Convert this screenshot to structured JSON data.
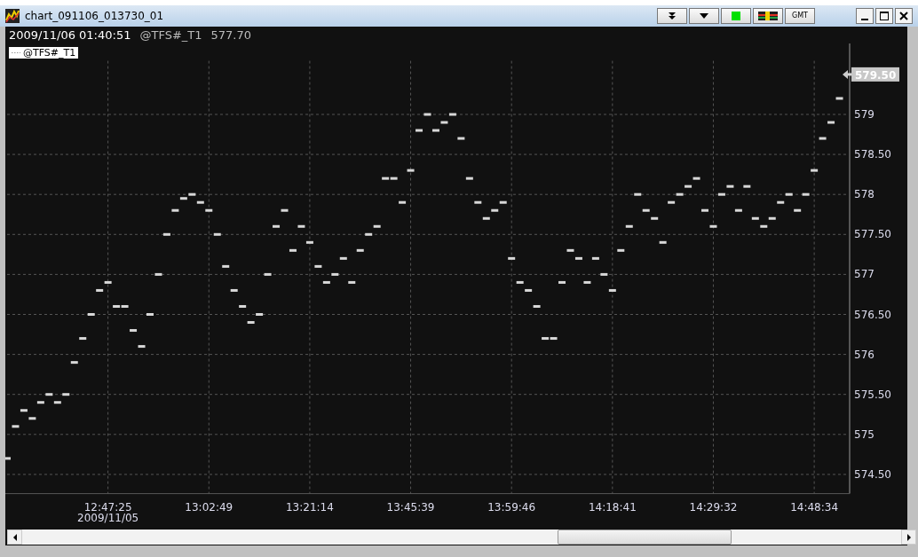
{
  "window": {
    "title": "chart_091106_013730_01"
  },
  "toolbar": [
    {
      "kind": "double-caret"
    },
    {
      "kind": "caret"
    },
    {
      "kind": "status",
      "color": "#00e000"
    },
    {
      "kind": "flag"
    },
    {
      "kind": "text",
      "label": "GMT"
    }
  ],
  "info": {
    "timestamp": "2009/11/06 01:40:51",
    "symbol": "@TFS#_T1",
    "price": "577.70"
  },
  "last_price": "579.50",
  "date_label": "2009/11/05",
  "chart_data": {
    "type": "scatter",
    "grid": true,
    "ylim": [
      574.26,
      579.67
    ],
    "yticks": [
      {
        "value": 574.5,
        "label": "574.50"
      },
      {
        "value": 575,
        "label": "575"
      },
      {
        "value": 575.5,
        "label": "575.50"
      },
      {
        "value": 576,
        "label": "576"
      },
      {
        "value": 576.5,
        "label": "576.50"
      },
      {
        "value": 577,
        "label": "577"
      },
      {
        "value": 577.5,
        "label": "577.50"
      },
      {
        "value": 578,
        "label": "578"
      },
      {
        "value": 578.5,
        "label": "578.50"
      },
      {
        "value": 579,
        "label": "579"
      }
    ],
    "categories": [
      null,
      null,
      null,
      null,
      null,
      null,
      null,
      null,
      null,
      null,
      null,
      null,
      "12:47:25",
      null,
      null,
      null,
      null,
      null,
      null,
      null,
      null,
      null,
      null,
      null,
      "13:02:49",
      null,
      null,
      null,
      null,
      null,
      null,
      null,
      null,
      null,
      null,
      null,
      "13:21:14",
      null,
      null,
      null,
      null,
      null,
      null,
      null,
      null,
      null,
      null,
      null,
      "13:45:39",
      null,
      null,
      null,
      null,
      null,
      null,
      null,
      null,
      null,
      null,
      null,
      "13:59:46",
      null,
      null,
      null,
      null,
      null,
      null,
      null,
      null,
      null,
      null,
      null,
      "14:18:41",
      null,
      null,
      null,
      null,
      null,
      null,
      null,
      null,
      null,
      null,
      null,
      "14:29:32",
      null,
      null,
      null,
      null,
      null,
      null,
      null,
      null,
      null,
      null,
      null,
      "14:48:34",
      null,
      null,
      null,
      null
    ],
    "series": [
      {
        "name": "@TFS#_T1",
        "color": "#d8d8d8",
        "values": [
          574.7,
          575.1,
          575.3,
          575.2,
          575.4,
          575.5,
          575.4,
          575.5,
          575.9,
          576.2,
          576.5,
          576.8,
          576.9,
          576.6,
          576.6,
          576.3,
          576.1,
          576.5,
          577.0,
          577.5,
          577.8,
          577.95,
          578.0,
          577.9,
          577.8,
          577.5,
          577.1,
          576.8,
          576.6,
          576.4,
          576.5,
          577.0,
          577.6,
          577.8,
          577.3,
          577.6,
          577.4,
          577.1,
          576.9,
          577.0,
          577.2,
          576.9,
          577.3,
          577.5,
          577.6,
          578.2,
          578.2,
          577.9,
          578.3,
          578.8,
          579.0,
          578.8,
          578.9,
          579.0,
          578.7,
          578.2,
          577.9,
          577.7,
          577.8,
          577.9,
          577.2,
          576.9,
          576.8,
          576.6,
          576.2,
          576.2,
          576.9,
          577.3,
          577.2,
          576.9,
          577.2,
          577.0,
          576.8,
          577.3,
          577.6,
          578.0,
          577.8,
          577.7,
          577.4,
          577.9,
          578.0,
          578.1,
          578.2,
          577.8,
          577.6,
          578.0,
          578.1,
          577.8,
          578.1,
          577.7,
          577.6,
          577.7,
          577.9,
          578.0,
          577.8,
          578.0,
          578.3,
          578.7,
          578.9,
          579.2,
          579.5
        ]
      }
    ]
  }
}
